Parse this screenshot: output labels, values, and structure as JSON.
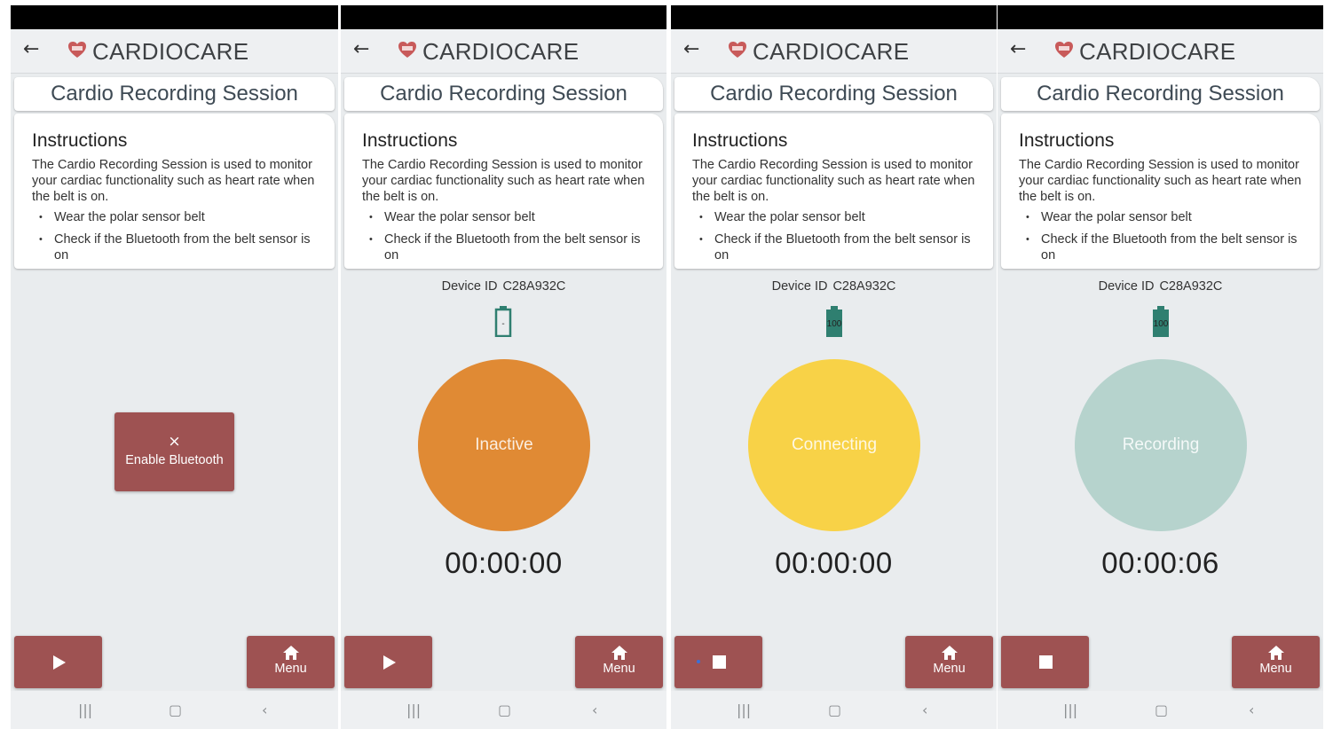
{
  "app": {
    "brand": "CARDIOCARE",
    "session_title": "Cardio Recording Session",
    "instructions_title": "Instructions",
    "instructions_text": "The Cardio Recording Session is used to monitor your cardiac functionality such as heart rate when the belt is on.",
    "bullet_1": "Wear the polar sensor belt",
    "bullet_2": "Check if the Bluetooth from the belt sensor is on",
    "device_label": "Device ID",
    "device_id": "C28A932C",
    "menu_label": "Menu",
    "enable_bluetooth_label": "Enable Bluetooth"
  },
  "screens": [
    {
      "state": "bluetooth-off"
    },
    {
      "state": "inactive",
      "battery_label": "-",
      "status_label": "Inactive",
      "status_color": "#e08a34",
      "timer": "00:00:00",
      "control": "play"
    },
    {
      "state": "connecting",
      "battery_label": "100",
      "status_label": "Connecting",
      "status_color": "#f8d247",
      "timer": "00:00:00",
      "control": "stop"
    },
    {
      "state": "recording",
      "battery_label": "100",
      "status_label": "Recording",
      "status_color": "#b6d3cd",
      "timer": "00:00:06",
      "control": "stop"
    }
  ],
  "colors": {
    "button": "#9e5252",
    "battery": "#2f7f70",
    "background": "#e9ecee"
  }
}
